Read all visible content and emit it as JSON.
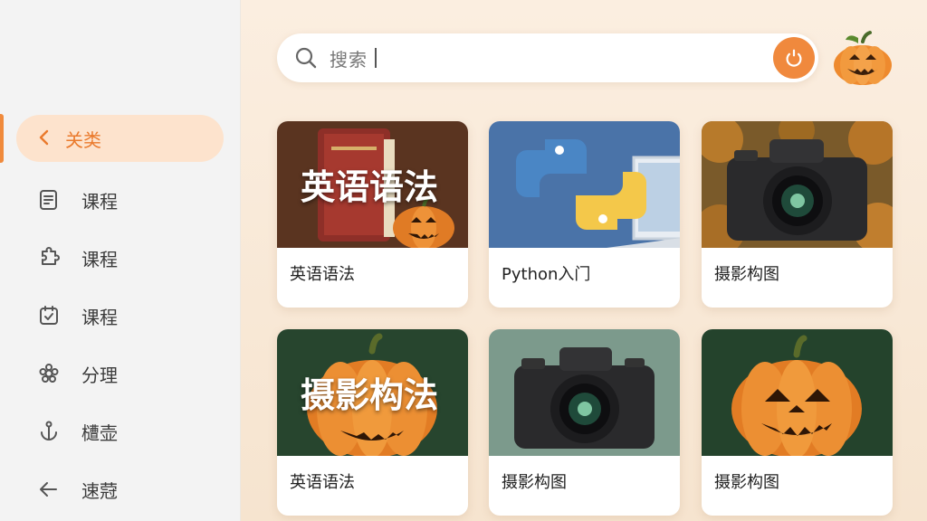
{
  "sidebar": {
    "active_item": {
      "label": "关类",
      "icon": "chevron-left-icon"
    },
    "items": [
      {
        "label": "课程",
        "icon": "note-icon"
      },
      {
        "label": "课程",
        "icon": "puzzle-icon"
      },
      {
        "label": "课程",
        "icon": "calendar-check-icon"
      },
      {
        "label": "分理",
        "icon": "settings-flower-icon"
      },
      {
        "label": "㯾壶",
        "icon": "anchor-icon"
      },
      {
        "label": "速蒄",
        "icon": "arrow-left-icon"
      }
    ]
  },
  "search": {
    "placeholder": "搜索",
    "refresh_icon": "refresh-icon",
    "search_icon": "search-icon"
  },
  "avatar": {
    "icon": "pumpkin-avatar-icon"
  },
  "cards": [
    {
      "title": "英语语法",
      "overlay": "英语语法",
      "image": "book-with-pumpkin"
    },
    {
      "title": "Python入门",
      "overlay": "",
      "image": "python-logo"
    },
    {
      "title": "摄影构图",
      "overlay": "",
      "image": "camera-on-pumpkins"
    },
    {
      "title": "英语语法",
      "overlay": "摄影构法",
      "image": "pumpkin"
    },
    {
      "title": "摄影构图",
      "overlay": "",
      "image": "camera"
    },
    {
      "title": "摄影构图",
      "overlay": "",
      "image": "pumpkin"
    }
  ],
  "colors": {
    "accent": "#f0893d",
    "sidebar_bg": "#f3f3f3",
    "main_bg": "#f7e6d2",
    "active_pill": "#fde3cd"
  }
}
